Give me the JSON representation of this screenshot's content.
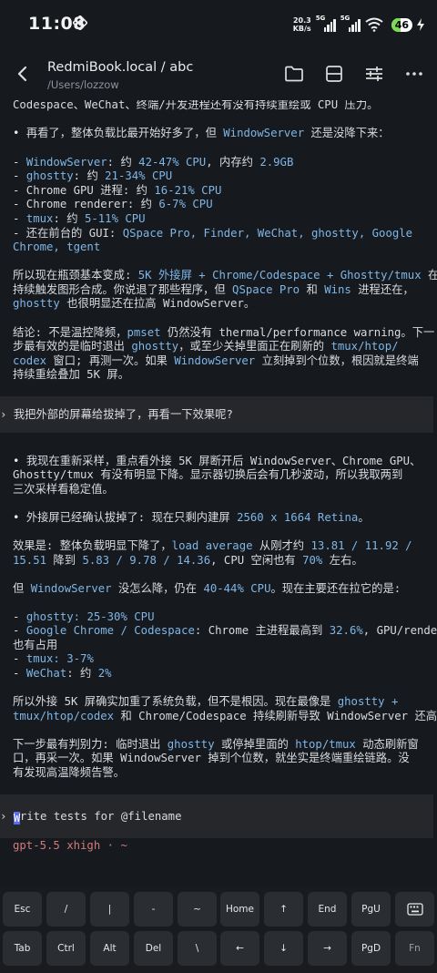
{
  "status_bar": {
    "time": "11:08",
    "speed_value": "20.3",
    "speed_unit": "KB/s",
    "net1": "5G",
    "net2": "5G",
    "battery": "46"
  },
  "header": {
    "title": "RedmiBook.local / abc",
    "subtitle": "/Users/lozzow"
  },
  "terminal": {
    "lines": [
      "Codespace、WeChat、终端/开发进程还有没有持续重绘或 CPU 压力。"
    ],
    "p1_bullet": "•",
    "p1": [
      "再看了，整体负载比最开始好多了，但 ",
      "WindowServer",
      " 还是没降下来："
    ],
    "list1": [
      [
        "- ",
        "WindowServer",
        ": 约 ",
        "42-47% CPU",
        ", 内存约 ",
        "2.9GB",
        ""
      ],
      [
        "- ",
        "ghostty",
        ": 约 ",
        "21-34% CPU",
        "",
        "",
        ""
      ],
      [
        "- Chrome GPU 进程: 约 ",
        "16-21% CPU",
        "",
        "",
        "",
        "",
        ""
      ],
      [
        "- Chrome renderer: 约 ",
        "6-7% CPU",
        "",
        "",
        "",
        "",
        ""
      ],
      [
        "- ",
        "tmux",
        ": 约 ",
        "5-11% CPU",
        "",
        "",
        ""
      ]
    ],
    "list1_last": [
      "- 还在前台的 GUI: ",
      "QSpace Pro, Finder, WeChat, ghostty, Google"
    ],
    "list1_last2": "Chrome, tgent",
    "para2": [
      [
        "所以现在瓶颈基本变成: ",
        "5K 外接屏 + Chrome/Codespace + Ghostty/tmux",
        " 在"
      ],
      [
        "持续触发图形合成。你说退了那些程序，但 ",
        "QSpace Pro",
        " 和 ",
        "Wins",
        " 进程还在，"
      ],
      [
        "",
        "ghostty",
        " 也很明显还在拉高 WindowServer。"
      ]
    ],
    "para3": [
      [
        "结论: 不是温控降频，",
        "pmset",
        " 仍然没有 thermal/performance warning。下一"
      ],
      [
        "步最有效的是临时退出 ",
        "ghostty",
        "，或至少关掉里面正在刷新的 ",
        "tmux/htop/"
      ],
      [
        "",
        "codex",
        " 窗口; 再测一次。如果 ",
        "WindowServer",
        " 立刻掉到个位数，根因就是终端"
      ],
      [
        "持续重绘叠加 5K 屏。"
      ]
    ],
    "user_msg": "我把外部的屏幕给拔掉了，再看一下效果呢?",
    "para4": [
      "我现在重新采样，重点看外接 5K 屏断开后 WindowServer、Chrome GPU、",
      "Ghostty/tmux 有没有明显下降。显示器切换后会有几秒波动，所以我取两到",
      "三次采样看稳定值。"
    ],
    "para5": [
      "外接屏已经确认拔掉了: 现在只剩内建屏 ",
      "2560 x 1664 Retina",
      "。"
    ],
    "para6": [
      [
        "效果是: 整体负载明显下降了，",
        "load average",
        " 从刚才约 ",
        "13.81 / 11.92 /"
      ],
      [
        "",
        "15.51",
        " 降到 ",
        "5.83 / 9.78 / 14.36",
        ", CPU 空闲也有 ",
        "70%",
        " 左右。"
      ]
    ],
    "para7": [
      "但 ",
      "WindowServer",
      " 没怎么降，仍在 ",
      "40-44% CPU",
      "。现在主要还在拉它的是:"
    ],
    "list2": [
      [
        "- ",
        "ghostty: 25-30% CPU",
        ""
      ],
      [
        "- ",
        "Google Chrome / Codespace",
        ": Chrome 主进程最高到 ",
        "32.6%",
        ", GPU/renderer"
      ],
      [
        "也有占用"
      ],
      [
        "- ",
        "tmux: 3-7%"
      ],
      [
        "- ",
        "WeChat",
        ": 约 ",
        "2%"
      ]
    ],
    "para8": [
      [
        "所以外接 5K 屏确实加重了系统负载，但不是根因。现在最像是 ",
        "ghostty +"
      ],
      [
        "",
        "tmux/htop/codex",
        " 和 Chrome/Codespace 持续刷新导致 WindowServer 还高。"
      ]
    ],
    "para9": [
      [
        "下一步最有判别力: 临时退出 ",
        "ghostty",
        " 或停掉里面的 ",
        "htop/tmux",
        " 动态刷新窗"
      ],
      [
        "口，再采一次。如果 WindowServer 掉到个位数，就坐实是终端重绘链路。没"
      ],
      [
        "有发现高温降频告警。"
      ]
    ],
    "prompt_caret": "›",
    "input_first_char": "W",
    "input_placeholder": "rite tests for @filename",
    "model_status": "gpt-5.5 xhigh · ~"
  },
  "keyboard": {
    "row1": [
      "Esc",
      "/",
      "|",
      "-",
      "~",
      "Home",
      "↑",
      "End",
      "PgU",
      "⌨"
    ],
    "row2": [
      "Tab",
      "Ctrl",
      "Alt",
      "Del",
      "\\",
      "←",
      "↓",
      "→",
      "PgD",
      "Fn"
    ]
  }
}
